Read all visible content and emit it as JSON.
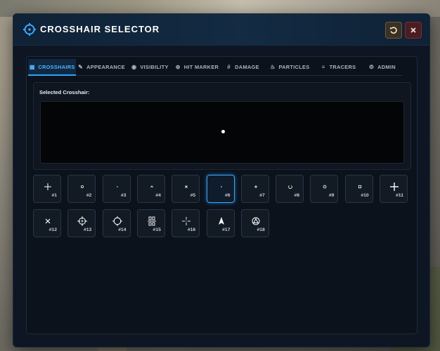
{
  "window": {
    "title": "CROSSHAIR SELECTOR"
  },
  "tabs": [
    {
      "label": "CROSSHAIRS",
      "icon": "grid-icon",
      "active": true
    },
    {
      "label": "APPEARANCE",
      "icon": "brush-icon",
      "active": false
    },
    {
      "label": "VISIBILITY",
      "icon": "eye-icon",
      "active": false
    },
    {
      "label": "HIT MARKER",
      "icon": "target-icon",
      "active": false
    },
    {
      "label": "DAMAGE",
      "icon": "hash-icon",
      "active": false
    },
    {
      "label": "PARTICLES",
      "icon": "flame-icon",
      "active": false
    },
    {
      "label": "TRACERS",
      "icon": "lines-icon",
      "active": false
    },
    {
      "label": "ADMIN",
      "icon": "user-cog-icon",
      "active": false
    }
  ],
  "preview": {
    "label": "Selected Crosshair:"
  },
  "crosshairs": [
    {
      "num": "#1",
      "glyph": "plus"
    },
    {
      "num": "#2",
      "glyph": "small-circle"
    },
    {
      "num": "#3",
      "glyph": "tiny-dot"
    },
    {
      "num": "#4",
      "glyph": "caret"
    },
    {
      "num": "#5",
      "glyph": "small-x"
    },
    {
      "num": "#6",
      "glyph": "dot",
      "selected": true
    },
    {
      "num": "#7",
      "glyph": "small-plus"
    },
    {
      "num": "#8",
      "glyph": "circle-gap"
    },
    {
      "num": "#9",
      "glyph": "ring-dot"
    },
    {
      "num": "#10",
      "glyph": "small-square"
    },
    {
      "num": "#11",
      "glyph": "big-plus"
    },
    {
      "num": "#12",
      "glyph": "x"
    },
    {
      "num": "#13",
      "glyph": "circle-cross"
    },
    {
      "num": "#14",
      "glyph": "circle-ticks"
    },
    {
      "num": "#15",
      "glyph": "bracket-plus"
    },
    {
      "num": "#16",
      "glyph": "gap-plus"
    },
    {
      "num": "#17",
      "glyph": "arrow"
    },
    {
      "num": "#18",
      "glyph": "circle-triangle"
    }
  ],
  "colors": {
    "accent": "#37a7ff",
    "window_bg": "#0d1622",
    "close": "#4a1d22",
    "reset": "#3a3123"
  }
}
